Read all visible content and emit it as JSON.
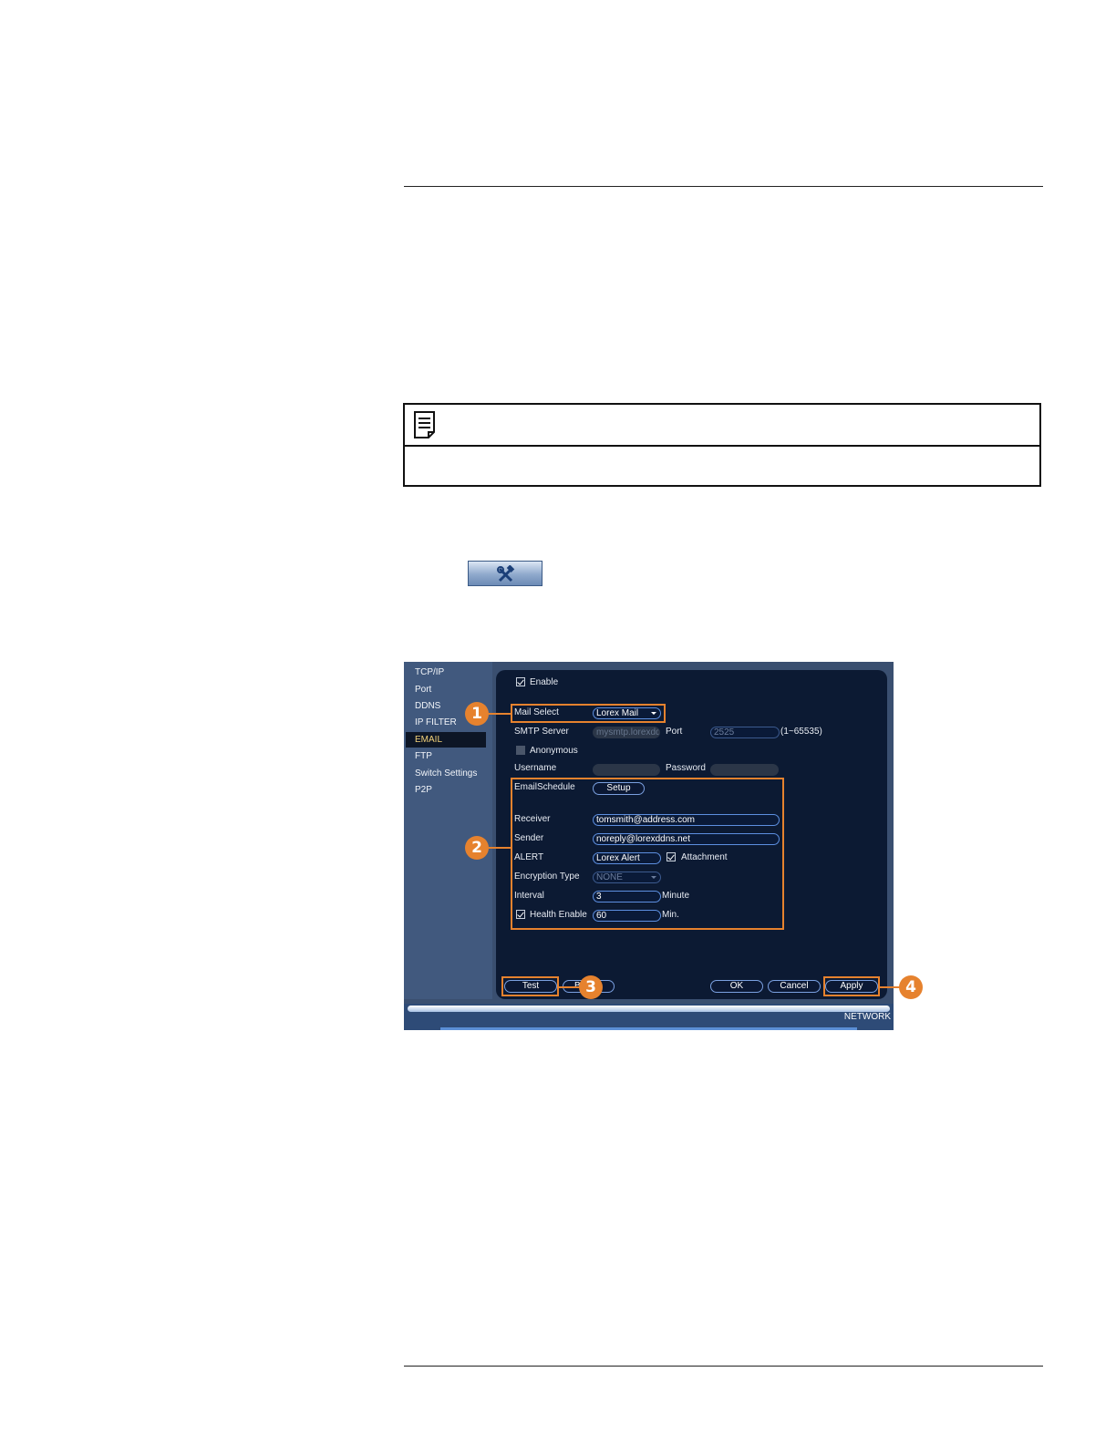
{
  "menu": {
    "items": [
      "TCP/IP",
      "Port",
      "DDNS",
      "IP FILTER",
      "EMAIL",
      "FTP",
      "Switch Settings",
      "P2P"
    ],
    "active": "EMAIL"
  },
  "email": {
    "enable_label": "Enable",
    "mail_select_label": "Mail Select",
    "mail_select_value": "Lorex Mail",
    "smtp_server_label": "SMTP Server",
    "smtp_server_value": "mysmtp.lorexdd",
    "port_label": "Port",
    "port_value": "2525",
    "port_range": "(1~65535)",
    "anonymous_label": "Anonymous",
    "username_label": "Username",
    "password_label": "Password",
    "schedule_label": "EmailSchedule",
    "setup_label": "Setup",
    "receiver_label": "Receiver",
    "receiver_value": "tomsmith@address.com",
    "sender_label": "Sender",
    "sender_value": "noreply@lorexddns.net",
    "alert_label": "ALERT",
    "alert_value": "Lorex Alert",
    "attachment_label": "Attachment",
    "encryption_label": "Encryption Type",
    "encryption_value": "NONE",
    "interval_label": "Interval",
    "interval_value": "3",
    "interval_unit": "Minute",
    "health_label": "Health Enable",
    "health_value": "60",
    "health_unit": "Min."
  },
  "buttons": {
    "test": "Test",
    "hidden": "B",
    "ok": "OK",
    "cancel": "Cancel",
    "apply": "Apply"
  },
  "callouts": [
    "1",
    "2",
    "3",
    "4"
  ],
  "footer_label": "NETWORK",
  "colors": {
    "highlight": "#e6822e",
    "panel": "#0c1a33",
    "menu_active_text": "#f3d27a"
  },
  "icons": [
    "note-icon",
    "tools-icon"
  ]
}
